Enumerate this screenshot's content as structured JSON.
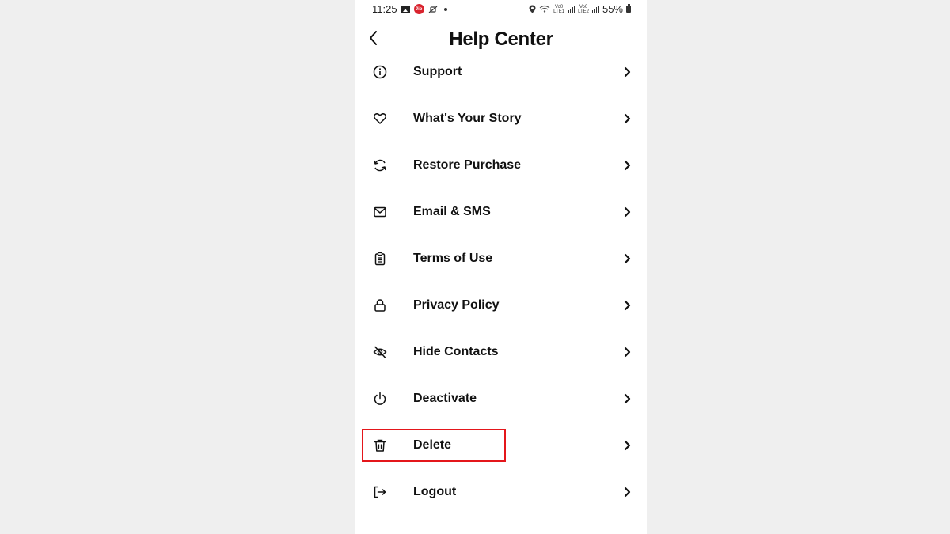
{
  "status_bar": {
    "time": "11:25",
    "left_icons": [
      "gallery-icon",
      "jio-icon",
      "vibrate-off-icon",
      "notification-dot"
    ],
    "jio_label": "Jio",
    "right_icons": [
      "location-icon",
      "wifi-icon",
      "volte-lte1-signal-icon",
      "volte-lte2-signal-icon",
      "battery-icon"
    ],
    "sim1_label_top": "Vo0",
    "sim1_label_bottom": "LTE1",
    "sim2_label_top": "Vo0",
    "sim2_label_bottom": "LTE2",
    "battery_percent": "55%"
  },
  "header": {
    "title": "Help Center",
    "back_icon": "chevron-left-icon"
  },
  "menu": {
    "items": [
      {
        "label": "Support",
        "icon": "info-icon"
      },
      {
        "label": "What's Your Story",
        "icon": "heart-icon"
      },
      {
        "label": "Restore Purchase",
        "icon": "refresh-icon"
      },
      {
        "label": "Email & SMS",
        "icon": "mail-icon"
      },
      {
        "label": "Terms of Use",
        "icon": "clipboard-icon"
      },
      {
        "label": "Privacy Policy",
        "icon": "lock-icon"
      },
      {
        "label": "Hide Contacts",
        "icon": "eye-off-icon"
      },
      {
        "label": "Deactivate",
        "icon": "power-icon"
      },
      {
        "label": "Delete",
        "icon": "trash-icon",
        "highlighted": true
      },
      {
        "label": "Logout",
        "icon": "logout-icon"
      }
    ]
  },
  "colors": {
    "page_background": "#efefef",
    "panel_background": "#ffffff",
    "text": "#111111",
    "highlight_border": "#e4161b",
    "jio_red": "#d9232e"
  }
}
